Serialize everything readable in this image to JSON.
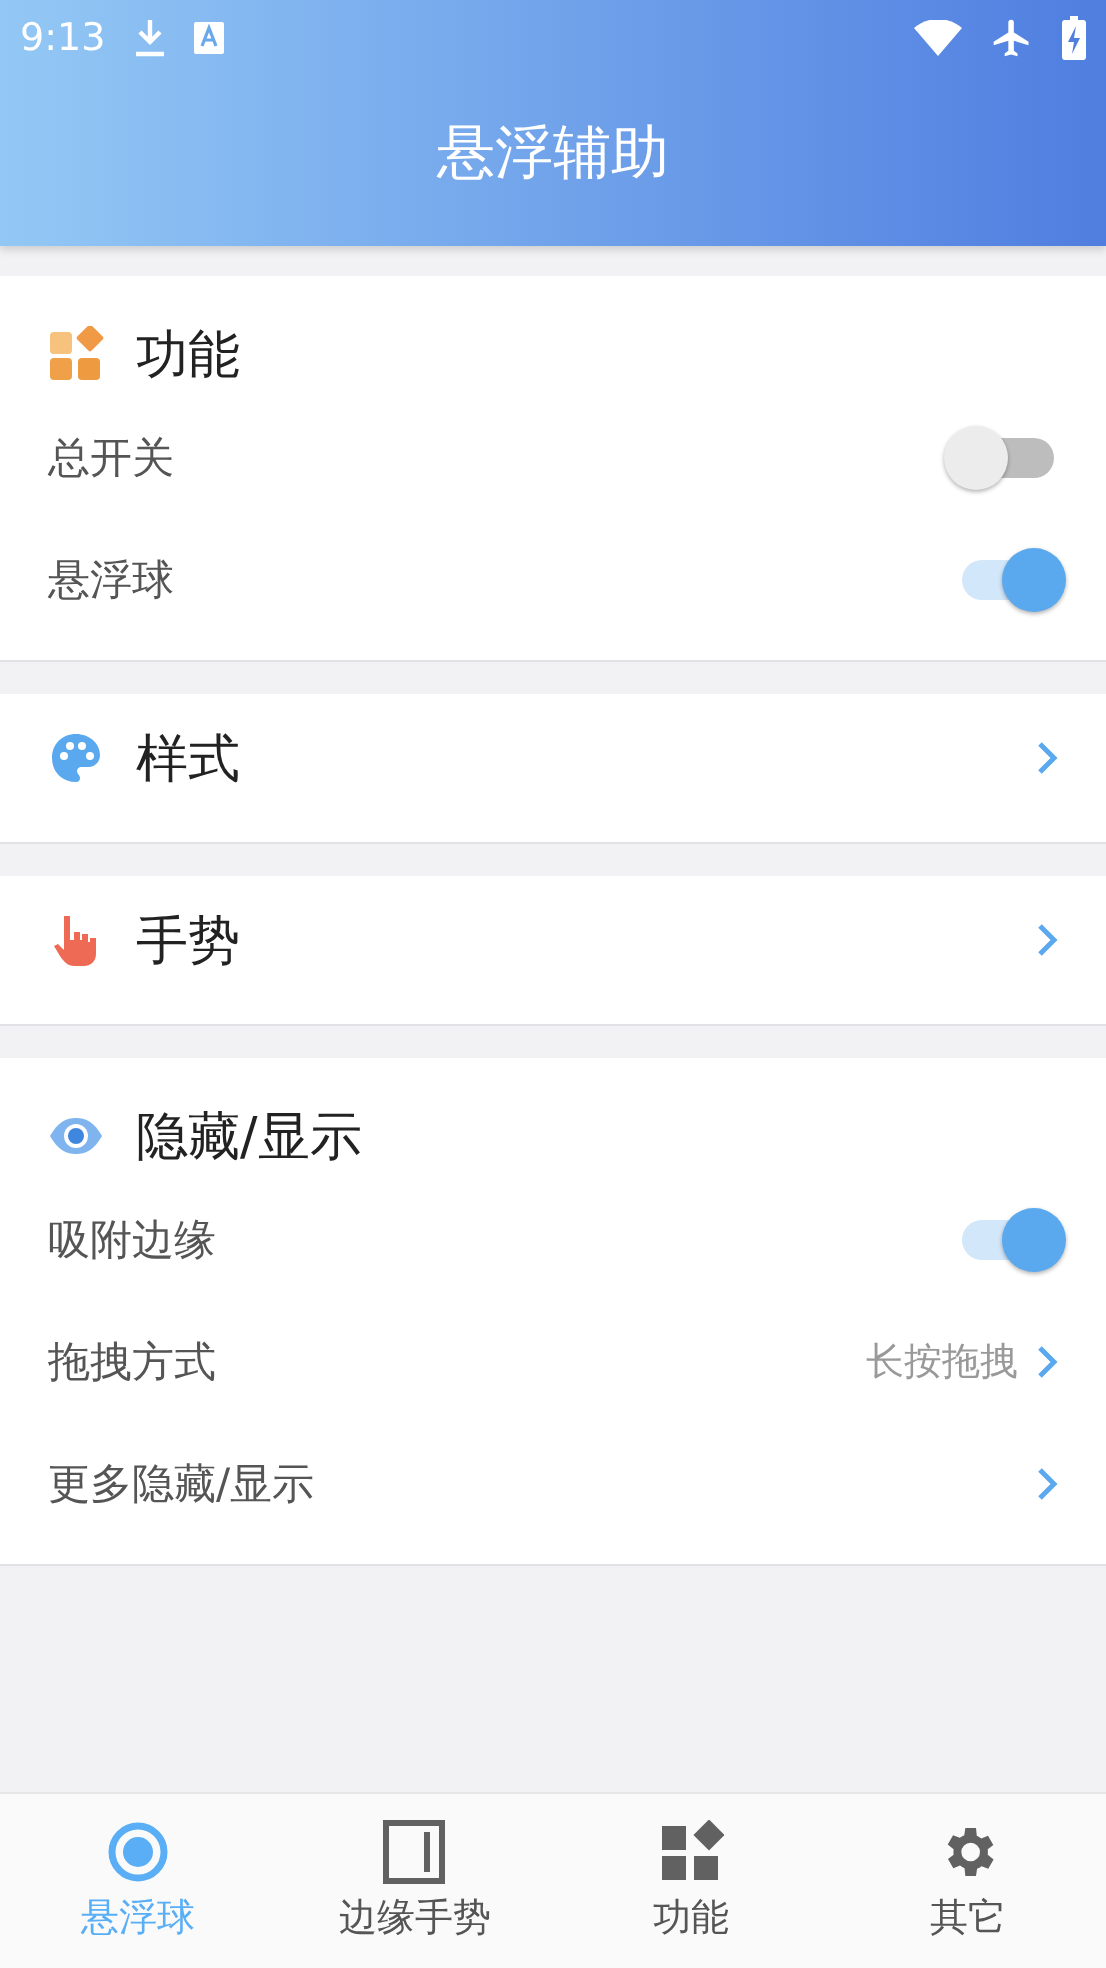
{
  "status_bar": {
    "time": "9:13"
  },
  "header": {
    "title": "悬浮辅助"
  },
  "sections": [
    {
      "title": "功能",
      "expandable": false,
      "rows": [
        {
          "kind": "toggle",
          "label": "总开关",
          "on": false
        },
        {
          "kind": "toggle",
          "label": "悬浮球",
          "on": true
        }
      ]
    },
    {
      "title": "样式",
      "expandable": true
    },
    {
      "title": "手势",
      "expandable": true
    },
    {
      "title": "隐藏/显示",
      "expandable": false,
      "rows": [
        {
          "kind": "toggle",
          "label": "吸附边缘",
          "on": true
        },
        {
          "kind": "link",
          "label": "拖拽方式",
          "value": "长按拖拽"
        },
        {
          "kind": "link",
          "label": "更多隐藏/显示"
        }
      ]
    }
  ],
  "bottom_nav": [
    {
      "label": "悬浮球",
      "selected": true
    },
    {
      "label": "边缘手势",
      "selected": false
    },
    {
      "label": "功能",
      "selected": false
    },
    {
      "label": "其它",
      "selected": false
    }
  ]
}
